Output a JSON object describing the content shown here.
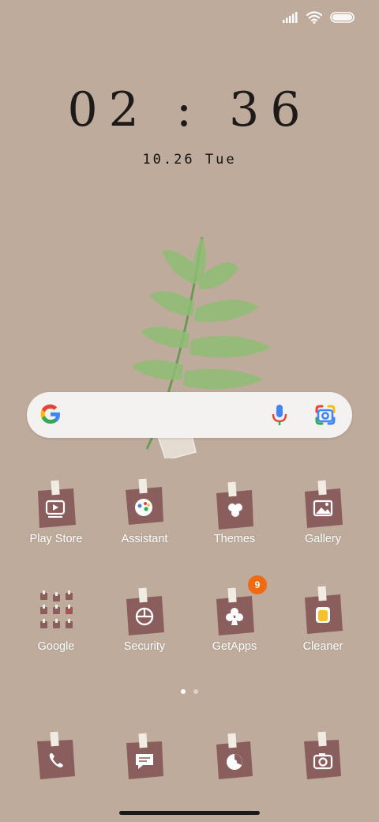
{
  "status_bar": {
    "signal_icon": "signal-icon",
    "wifi_icon": "wifi-icon",
    "battery_icon": "battery-icon"
  },
  "clock": {
    "time": "02 : 36",
    "date": "10.26 Tue"
  },
  "search_bar": {
    "google_icon": "google-g-icon",
    "voice_icon": "mic-icon",
    "lens_icon": "lens-icon"
  },
  "apps_row1": [
    {
      "label": "Play Store",
      "icon": "play-store-icon"
    },
    {
      "label": "Assistant",
      "icon": "assistant-icon"
    },
    {
      "label": "Themes",
      "icon": "themes-icon"
    },
    {
      "label": "Gallery",
      "icon": "gallery-icon"
    }
  ],
  "apps_row2": [
    {
      "label": "Google",
      "icon": "google-folder-icon"
    },
    {
      "label": "Security",
      "icon": "security-icon"
    },
    {
      "label": "GetApps",
      "icon": "getapps-icon",
      "badge": "9"
    },
    {
      "label": "Cleaner",
      "icon": "cleaner-icon"
    }
  ],
  "dock": [
    {
      "icon": "phone-icon"
    },
    {
      "icon": "messages-icon"
    },
    {
      "icon": "browser-icon"
    },
    {
      "icon": "camera-icon"
    }
  ],
  "page_indicator": {
    "pages": 2,
    "active": 1
  },
  "colors": {
    "background": "#bfab9b",
    "tile": "#8b5e5e",
    "badge": "#f06a12"
  }
}
